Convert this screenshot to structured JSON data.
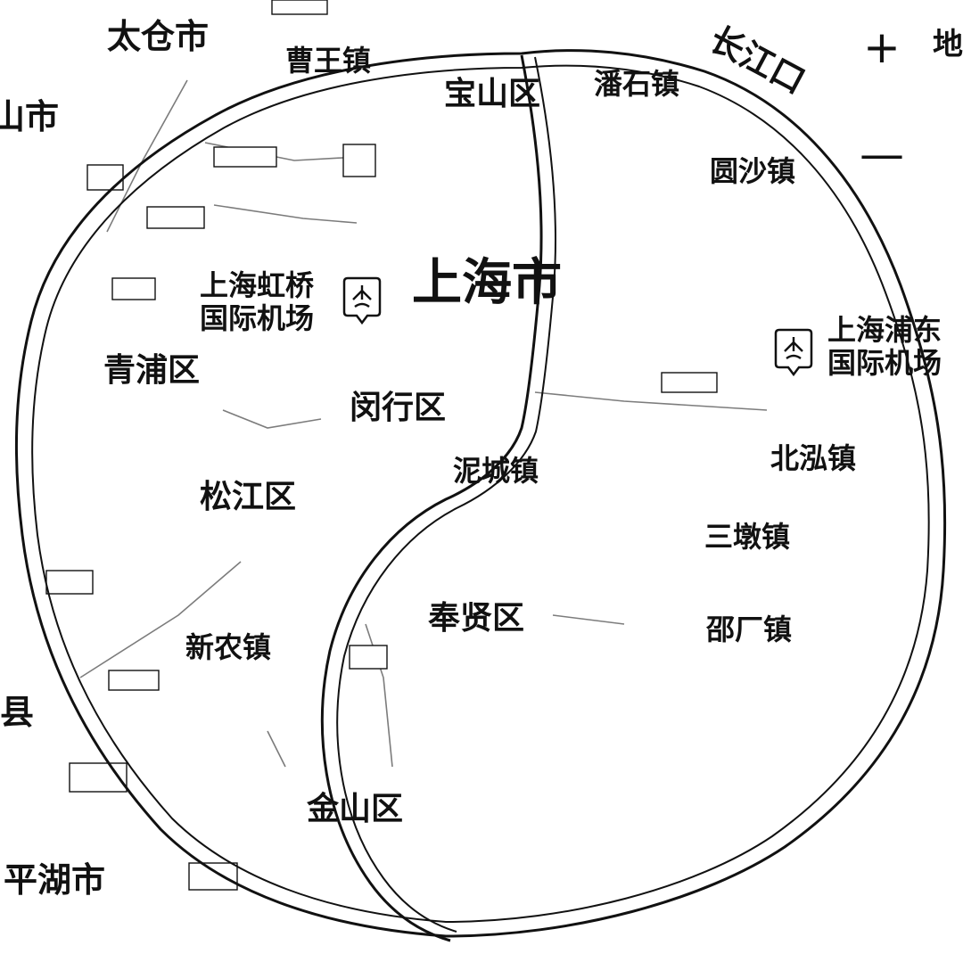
{
  "map": {
    "region_title": "上海市",
    "cities": {
      "taicang": "太仓市",
      "kunshan": "山市",
      "pinghu": "平湖市",
      "county": "县"
    },
    "districts": {
      "baoshan": "宝山区",
      "qingpu": "青浦区",
      "minhang": "闵行区",
      "songjiang": "松江区",
      "fengxian": "奉贤区",
      "jinshan": "金山区"
    },
    "towns": {
      "caowang": "曹王镇",
      "luodian": "潘石镇",
      "yuansha": "圆沙镇",
      "nicheng": "泥城镇",
      "beihong": "北泓镇",
      "sandun": "三墩镇",
      "shaochang": "邵厂镇",
      "xinnong": "新农镇"
    },
    "river": "长江口",
    "airports": {
      "hongqiao": "上海虹桥\n国际机场",
      "pudong": "上海浦东\n国际机场"
    },
    "controls": {
      "zoom_in": "+",
      "zoom_out": "—",
      "layer": "地"
    },
    "colors": {
      "line": "#111111",
      "background": "#ffffff"
    },
    "icons": {
      "airport": "airport-icon",
      "zoom_in": "plus-icon",
      "zoom_out": "minus-icon"
    }
  }
}
